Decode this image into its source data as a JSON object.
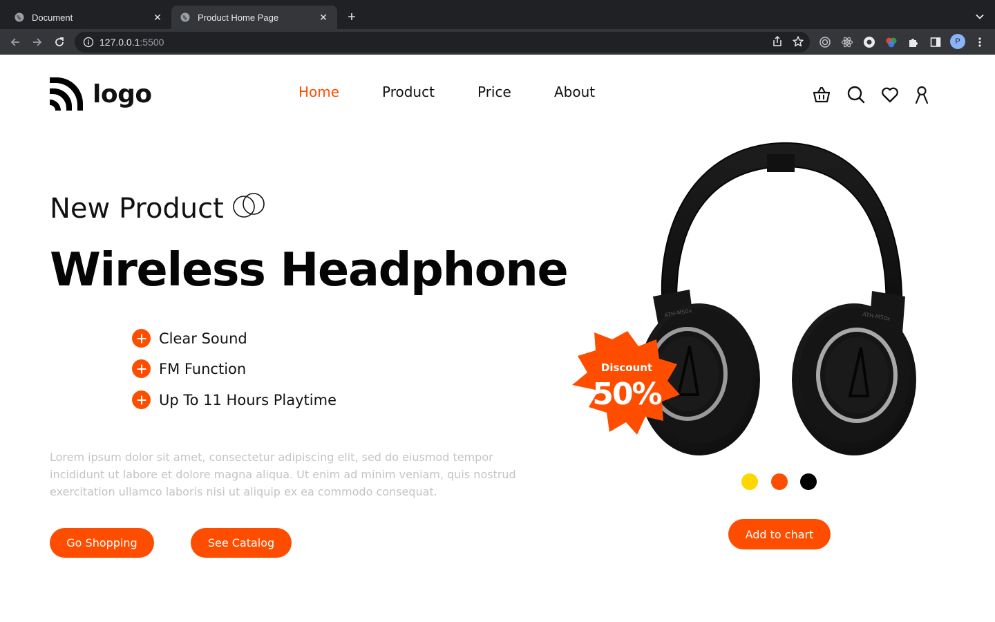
{
  "browser": {
    "tabs": [
      {
        "title": "Document",
        "active": false
      },
      {
        "title": "Product Home Page",
        "active": true
      }
    ],
    "url_host": "127.0.0.1",
    "url_port": ":5500"
  },
  "header": {
    "logo_text": "logo",
    "nav": [
      {
        "label": "Home",
        "active": true
      },
      {
        "label": "Product",
        "active": false
      },
      {
        "label": "Price",
        "active": false
      },
      {
        "label": "About",
        "active": false
      }
    ],
    "icons": [
      "basket-icon",
      "search-icon",
      "heart-icon",
      "user-icon"
    ]
  },
  "hero": {
    "eyebrow": "New Product",
    "headline": "Wireless Headphone",
    "features": [
      "Clear Sound",
      "FM Function",
      "Up To 11 Hours Playtime"
    ],
    "description": "Lorem ipsum dolor sit amet, consectetur adipiscing elit, sed do eiusmod tempor incididunt ut labore et dolore magna aliqua. Ut enim ad minim veniam, quis nostrud exercitation ullamco laboris nisi ut aliquip ex ea commodo consequat.",
    "buttons": {
      "shop": "Go Shopping",
      "catalog": "See Catalog"
    }
  },
  "product": {
    "badge_label": "Discount",
    "badge_value": "50%",
    "model_left": "ATH-M50x",
    "model_right": "ATH-M50x",
    "colors": [
      "#ffd600",
      "#ff4d00",
      "#000000"
    ],
    "cart_button": "Add to chart"
  },
  "theme": {
    "accent": "#ff4d00"
  }
}
